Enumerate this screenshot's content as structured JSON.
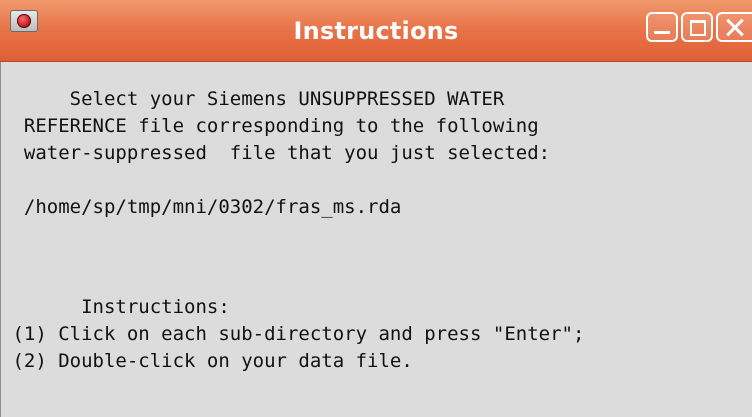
{
  "window": {
    "title": "Instructions",
    "icon": "app-icon",
    "controls": [
      "minimize-icon",
      "maximize-icon",
      "close-icon"
    ]
  },
  "message": {
    "line1": "      Select your Siemens UNSUPPRESSED WATER",
    "line2": "  REFERENCE file corresponding to the following",
    "line3": "  water-suppressed  file that you just selected:",
    "line4": "",
    "line5": "  /home/sp/tmp/mni/0302/fras_ms.rda"
  },
  "instructions": {
    "heading": "       Instructions:",
    "step1": " (1) Click on each sub-directory and press \"Enter\";",
    "step2": " (2) Double-click on your data file."
  },
  "colors": {
    "titlebar": "#e9754a",
    "background": "#dcdcdc"
  }
}
